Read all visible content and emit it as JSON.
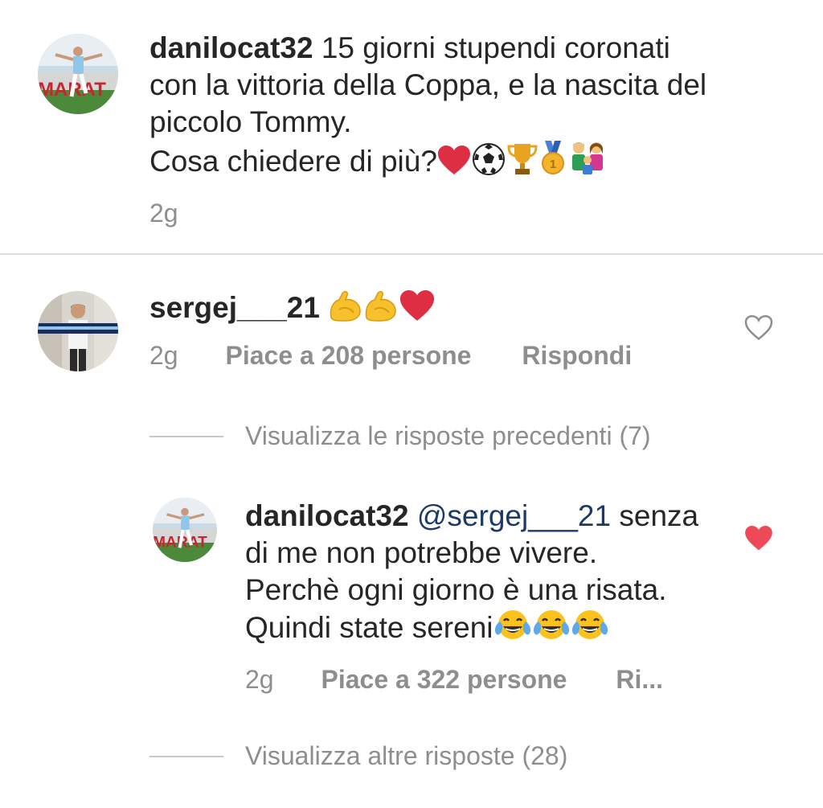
{
  "caption": {
    "username": "danilocat32",
    "text_line1": " 15 giorni stupendi coronati",
    "text_line2": "con la vittoria della Coppa, e la nascita del",
    "text_line3": "piccolo Tommy.",
    "text_line4": "Cosa chiedere di più?",
    "emojis": [
      "heart",
      "soccer-ball",
      "trophy",
      "medal",
      "family"
    ],
    "time": "2g"
  },
  "comment1": {
    "username": "sergej___21",
    "emojis": [
      "flexed-biceps",
      "flexed-biceps",
      "heart"
    ],
    "time": "2g",
    "likes": "Piace a 208 persone",
    "reply": "Rispondi",
    "liked": false
  },
  "view_previous": "Visualizza le risposte precedenti (7)",
  "reply1": {
    "username": "danilocat32",
    "mention": "@sergej___21",
    "text_line1": " senza",
    "text_line2": "di me non potrebbe vivere.",
    "text_line3": "Perchè ogni giorno è una risata.",
    "text_line4": "Quindi state sereni",
    "emojis": [
      "tears-of-joy",
      "tears-of-joy",
      "tears-of-joy"
    ],
    "time": "2g",
    "likes": "Piace a 322 persone",
    "reply": "Ri...",
    "liked": true
  },
  "view_more": "Visualizza altre risposte (28)",
  "colors": {
    "heart_liked": "#ed4956",
    "heart_outline": "#8e8e8e",
    "secondary_text": "#8e8e8e",
    "mention": "#1b3a6b"
  }
}
